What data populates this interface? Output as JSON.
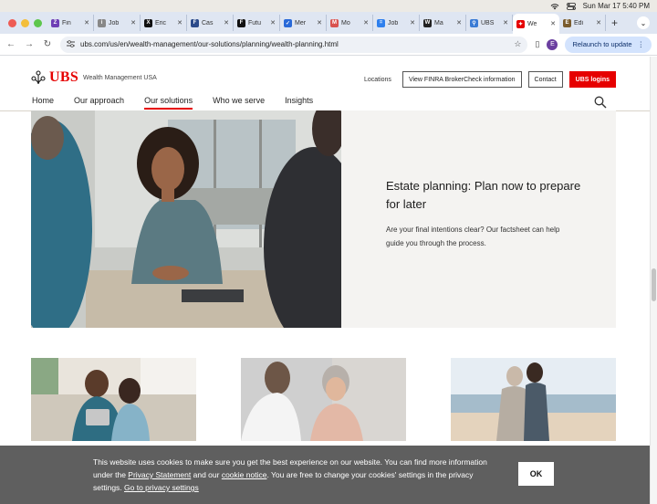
{
  "menubar": {
    "datetime": "Sun Mar 17  5:40 PM"
  },
  "tabs": [
    {
      "label": "Fin",
      "icon": "z-icon",
      "color": "#6e3fb5",
      "glyph": "Z"
    },
    {
      "label": "Job",
      "icon": "info-icon",
      "color": "#888888",
      "glyph": "i"
    },
    {
      "label": "Eric",
      "icon": "x-icon",
      "color": "#111111",
      "glyph": "X"
    },
    {
      "label": "Cas",
      "icon": "ftc-icon",
      "color": "#2b4a8a",
      "glyph": "F"
    },
    {
      "label": "Futu",
      "icon": "f-icon",
      "color": "#111111",
      "glyph": "F"
    },
    {
      "label": "Mer",
      "icon": "check-icon",
      "color": "#2a6ad8",
      "glyph": "✓"
    },
    {
      "label": "Mo",
      "icon": "mo-icon",
      "color": "#d9534f",
      "glyph": "M"
    },
    {
      "label": "Job",
      "icon": "job-icon",
      "color": "#2f80ed",
      "glyph": "="
    },
    {
      "label": "Ma",
      "icon": "w-icon",
      "color": "#222222",
      "glyph": "W"
    },
    {
      "label": "UBS",
      "icon": "person-icon",
      "color": "#3a7bd5",
      "glyph": "⚲"
    },
    {
      "label": "We",
      "icon": "ubs-keys-icon",
      "color": "#e60000",
      "glyph": "✦"
    },
    {
      "label": "Edi",
      "icon": "edit-icon",
      "color": "#7a5c2e",
      "glyph": "E"
    }
  ],
  "active_tab_index": 10,
  "addressbar": {
    "url": "ubs.com/us/en/wealth-management/our-solutions/planning/wealth-planning.html",
    "profile_letter": "E",
    "relaunch_label": "Relaunch to update"
  },
  "header": {
    "brand": "UBS",
    "sub_brand": "Wealth Management USA",
    "locations": "Locations",
    "finra_button": "View FINRA BrokerCheck information",
    "contact_button": "Contact",
    "logins_button": "UBS logins",
    "nav": [
      {
        "label": "Home",
        "active": false
      },
      {
        "label": "Our approach",
        "active": false
      },
      {
        "label": "Our solutions",
        "active": true
      },
      {
        "label": "Who we serve",
        "active": false
      },
      {
        "label": "Insights",
        "active": false
      }
    ]
  },
  "hero": {
    "title": "Estate planning: Plan now to prepare for later",
    "body": "Are your final intentions clear? Our factsheet can help guide you through the process."
  },
  "cookie": {
    "text_1": "This website uses cookies to make sure you get the best experience on our website. You can find more information under the ",
    "link_privacy": "Privacy Statement",
    "text_2": " and our ",
    "link_cookie": "cookie notice",
    "text_3": ". You are free to change your cookies' settings in the privacy settings. ",
    "link_settings": "Go to privacy settings",
    "ok_label": "OK"
  },
  "colors": {
    "brand_red": "#e60000",
    "tabstrip": "#dfe6f2",
    "cookie_bg": "#5f5f5f"
  }
}
